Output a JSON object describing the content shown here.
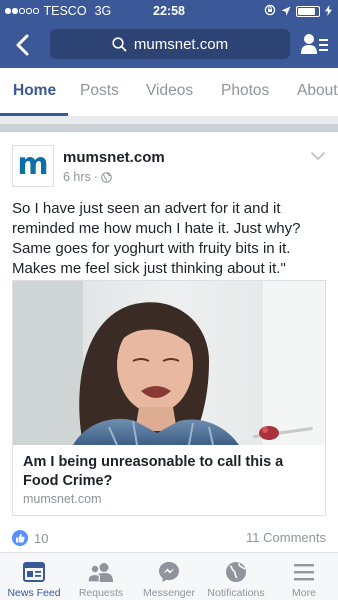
{
  "status_bar": {
    "carrier": "TESCO",
    "network": "3G",
    "time": "22:58",
    "battery_level": 0.85
  },
  "nav": {
    "search_text": "mumsnet.com"
  },
  "tabs": [
    {
      "label": "Home",
      "active": true
    },
    {
      "label": "Posts",
      "active": false
    },
    {
      "label": "Videos",
      "active": false
    },
    {
      "label": "Photos",
      "active": false
    },
    {
      "label": "About",
      "active": false
    }
  ],
  "post": {
    "avatar_letter": "m",
    "page_name": "mumsnet.com",
    "time_ago": "6 hrs",
    "separator": "·",
    "text": "So I have just seen an advert for it and it reminded me how much I hate it.  Just why? Same goes for yoghurt with fruity bits in it. Makes me feel sick just thinking about it.\"",
    "link": {
      "title": "Am I being unreasonable to call this a Food Crime?",
      "domain": "mumsnet.com"
    },
    "likes": "10",
    "comments": "11 Comments"
  },
  "bottom_bar": [
    {
      "label": "News Feed",
      "icon": "news-feed-icon",
      "active": true
    },
    {
      "label": "Requests",
      "icon": "friend-requests-icon",
      "active": false
    },
    {
      "label": "Messenger",
      "icon": "messenger-icon",
      "active": false
    },
    {
      "label": "Notifications",
      "icon": "globe-icon",
      "active": false
    },
    {
      "label": "More",
      "icon": "menu-icon",
      "active": false
    }
  ],
  "colors": {
    "brand": "#3b5998",
    "search_bg": "#2d4373",
    "like_blue": "#5890ff",
    "muted_text": "#90949c"
  }
}
